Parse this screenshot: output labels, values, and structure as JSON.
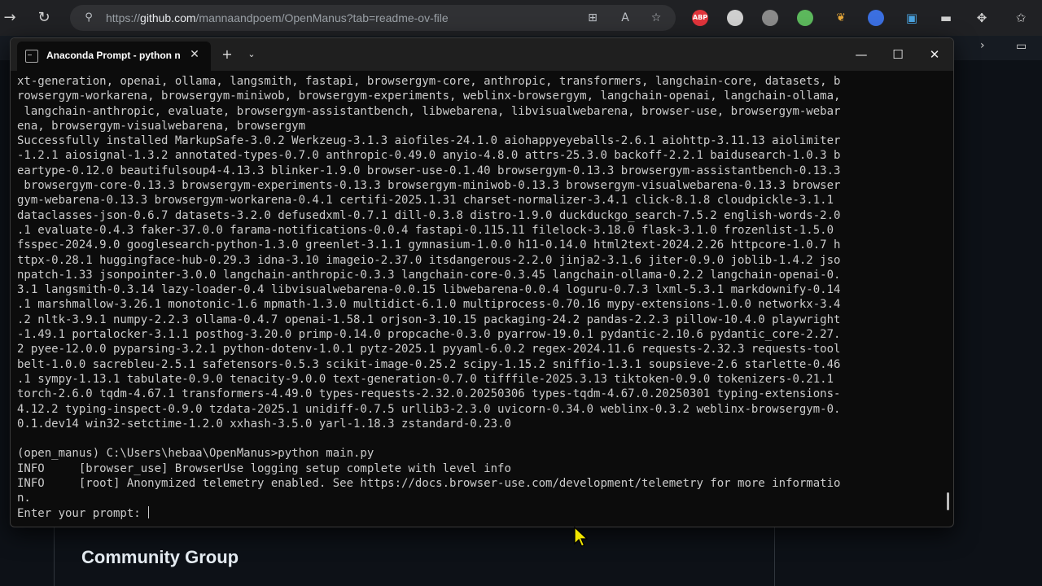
{
  "browser": {
    "url_prefix": "https://",
    "url_host": "github.com",
    "url_path": "/mannaandpoem/OpenManus?tab=readme-ov-file",
    "extensions": [
      {
        "name": "adblock-plus",
        "label": "ABP",
        "color": "#e0343b"
      },
      {
        "name": "extension-2",
        "label": "",
        "color": "#aaaaaa"
      },
      {
        "name": "extension-3",
        "label": "",
        "color": "#8a8a8a"
      },
      {
        "name": "extension-4",
        "label": "",
        "color": "#5cb85c"
      },
      {
        "name": "extension-5",
        "label": "",
        "color": "#e8a93a"
      },
      {
        "name": "extension-6",
        "label": "",
        "color": "#3b6fe0"
      }
    ]
  },
  "github": {
    "heading": "Community Group"
  },
  "terminal": {
    "tab_title": "Anaconda Prompt - python  n",
    "lines": [
      "xt-generation, openai, ollama, langsmith, fastapi, browsergym-core, anthropic, transformers, langchain-core, datasets, b",
      "rowsergym-workarena, browsergym-miniwob, browsergym-experiments, weblinx-browsergym, langchain-openai, langchain-ollama,",
      " langchain-anthropic, evaluate, browsergym-assistantbench, libwebarena, libvisualwebarena, browser-use, browsergym-webar",
      "ena, browsergym-visualwebarena, browsergym",
      "Successfully installed MarkupSafe-3.0.2 Werkzeug-3.1.3 aiofiles-24.1.0 aiohappyeyeballs-2.6.1 aiohttp-3.11.13 aiolimiter",
      "-1.2.1 aiosignal-1.3.2 annotated-types-0.7.0 anthropic-0.49.0 anyio-4.8.0 attrs-25.3.0 backoff-2.2.1 baidusearch-1.0.3 b",
      "eartype-0.12.0 beautifulsoup4-4.13.3 blinker-1.9.0 browser-use-0.1.40 browsergym-0.13.3 browsergym-assistantbench-0.13.3",
      " browsergym-core-0.13.3 browsergym-experiments-0.13.3 browsergym-miniwob-0.13.3 browsergym-visualwebarena-0.13.3 browser",
      "gym-webarena-0.13.3 browsergym-workarena-0.4.1 certifi-2025.1.31 charset-normalizer-3.4.1 click-8.1.8 cloudpickle-3.1.1",
      "dataclasses-json-0.6.7 datasets-3.2.0 defusedxml-0.7.1 dill-0.3.8 distro-1.9.0 duckduckgo_search-7.5.2 english-words-2.0",
      ".1 evaluate-0.4.3 faker-37.0.0 farama-notifications-0.0.4 fastapi-0.115.11 filelock-3.18.0 flask-3.1.0 frozenlist-1.5.0",
      "fsspec-2024.9.0 googlesearch-python-1.3.0 greenlet-3.1.1 gymnasium-1.0.0 h11-0.14.0 html2text-2024.2.26 httpcore-1.0.7 h",
      "ttpx-0.28.1 huggingface-hub-0.29.3 idna-3.10 imageio-2.37.0 itsdangerous-2.2.0 jinja2-3.1.6 jiter-0.9.0 joblib-1.4.2 jso",
      "npatch-1.33 jsonpointer-3.0.0 langchain-anthropic-0.3.3 langchain-core-0.3.45 langchain-ollama-0.2.2 langchain-openai-0.",
      "3.1 langsmith-0.3.14 lazy-loader-0.4 libvisualwebarena-0.0.15 libwebarena-0.0.4 loguru-0.7.3 lxml-5.3.1 markdownify-0.14",
      ".1 marshmallow-3.26.1 monotonic-1.6 mpmath-1.3.0 multidict-6.1.0 multiprocess-0.70.16 mypy-extensions-1.0.0 networkx-3.4",
      ".2 nltk-3.9.1 numpy-2.2.3 ollama-0.4.7 openai-1.58.1 orjson-3.10.15 packaging-24.2 pandas-2.2.3 pillow-10.4.0 playwright",
      "-1.49.1 portalocker-3.1.1 posthog-3.20.0 primp-0.14.0 propcache-0.3.0 pyarrow-19.0.1 pydantic-2.10.6 pydantic_core-2.27.",
      "2 pyee-12.0.0 pyparsing-3.2.1 python-dotenv-1.0.1 pytz-2025.1 pyyaml-6.0.2 regex-2024.11.6 requests-2.32.3 requests-tool",
      "belt-1.0.0 sacrebleu-2.5.1 safetensors-0.5.3 scikit-image-0.25.2 scipy-1.15.2 sniffio-1.3.1 soupsieve-2.6 starlette-0.46",
      ".1 sympy-1.13.1 tabulate-0.9.0 tenacity-9.0.0 text-generation-0.7.0 tifffile-2025.3.13 tiktoken-0.9.0 tokenizers-0.21.1",
      "torch-2.6.0 tqdm-4.67.1 transformers-4.49.0 types-requests-2.32.0.20250306 types-tqdm-4.67.0.20250301 typing-extensions-",
      "4.12.2 typing-inspect-0.9.0 tzdata-2025.1 unidiff-0.7.5 urllib3-2.3.0 uvicorn-0.34.0 weblinx-0.3.2 weblinx-browsergym-0.",
      "0.1.dev14 win32-setctime-1.2.0 xxhash-3.5.0 yarl-1.18.3 zstandard-0.23.0",
      "",
      "(open_manus) C:\\Users\\hebaa\\OpenManus>python main.py",
      "INFO     [browser_use] BrowserUse logging setup complete with level info",
      "INFO     [root] Anonymized telemetry enabled. See https://docs.browser-use.com/development/telemetry for more informatio",
      "n."
    ],
    "prompt": "Enter your prompt: "
  }
}
